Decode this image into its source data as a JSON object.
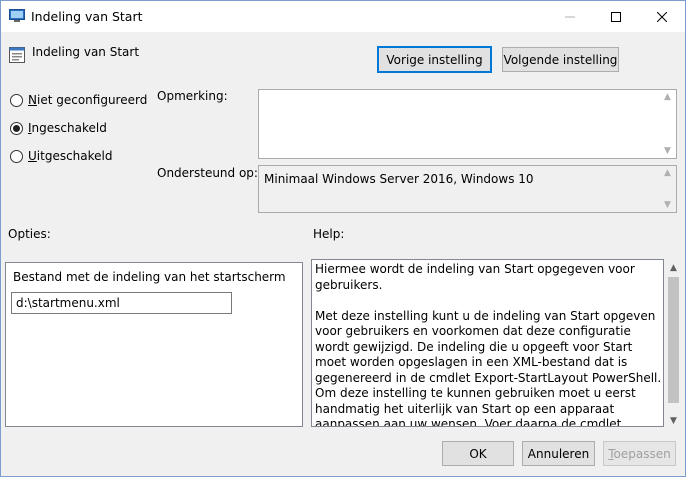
{
  "window": {
    "title": "Indeling van Start"
  },
  "header": {
    "title": "Indeling van Start"
  },
  "nav": {
    "prev_label": "Vorige instelling",
    "next_label": "Volgende instelling"
  },
  "state": {
    "options": [
      {
        "prefix": "N",
        "rest": "iet geconfigureerd",
        "selected": false
      },
      {
        "prefix": "I",
        "rest": "ngeschakeld",
        "selected": true
      },
      {
        "prefix": "U",
        "rest": "itgeschakeld",
        "selected": false
      }
    ]
  },
  "comment": {
    "label": "Opmerking:",
    "value": ""
  },
  "supported": {
    "label": "Ondersteund op:",
    "value": "Minimaal Windows Server 2016, Windows 10"
  },
  "options_section": {
    "label": "Opties:",
    "field_label": "Bestand met de indeling van het startscherm",
    "field_value": "d:\\startmenu.xml"
  },
  "help_section": {
    "label": "Help:",
    "text": "Hiermee wordt de indeling van Start opgegeven voor gebruikers.\n\nMet deze instelling kunt u de indeling van Start opgeven voor gebruikers en voorkomen dat deze configuratie wordt gewijzigd. De indeling die u opgeeft voor Start moet worden opgeslagen in een XML-bestand dat is gegenereerd in de cmdlet Export-StartLayout PowerShell.\nOm deze instelling te kunnen gebruiken moet u eerst handmatig het uiterlijk van Start op een apparaat aanpassen aan uw wensen. Voer daarna de cmdlet Export-StartLayout PowerShell uit op"
  },
  "footer": {
    "ok_label": "OK",
    "cancel_label": "Annuleren",
    "apply_label": "Toepassen"
  }
}
